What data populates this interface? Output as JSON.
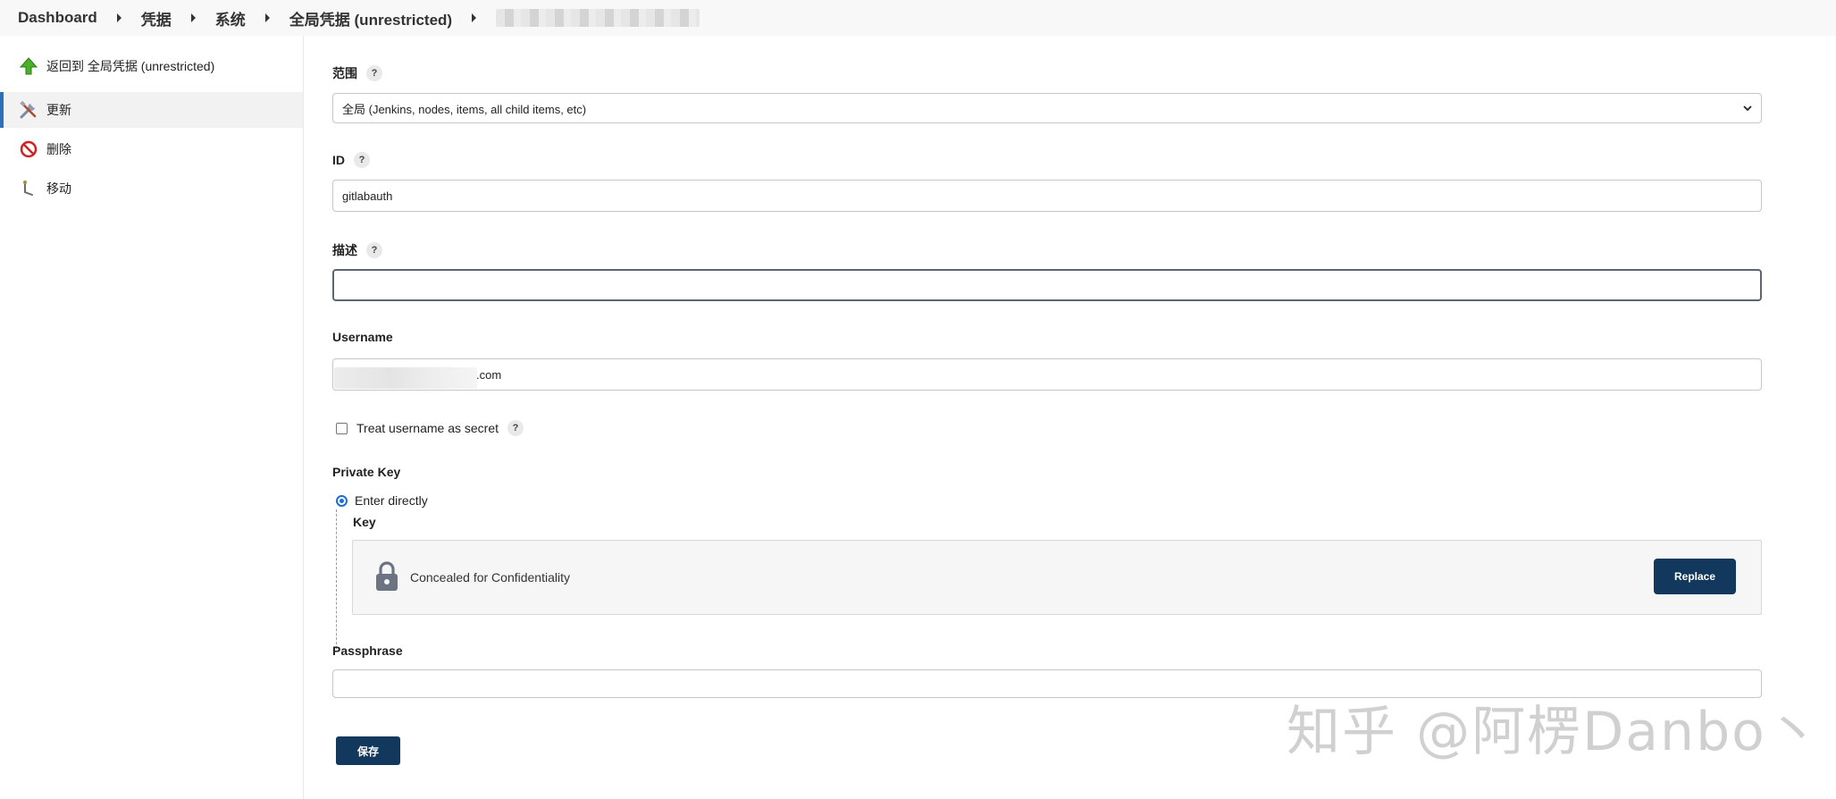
{
  "breadcrumb": {
    "items": [
      "Dashboard",
      "凭据",
      "系统",
      "全局凭据 (unrestricted)"
    ]
  },
  "sidebar": {
    "items": [
      {
        "label": "返回到 全局凭据 (unrestricted)",
        "icon": "arrow-up-icon"
      },
      {
        "label": "更新",
        "icon": "tools-icon"
      },
      {
        "label": "删除",
        "icon": "no-entry-icon"
      },
      {
        "label": "移动",
        "icon": "move-icon"
      }
    ],
    "active_index": 1
  },
  "form": {
    "scope": {
      "label": "范围",
      "help": "?",
      "value": "全局 (Jenkins, nodes, items, all child items, etc)"
    },
    "id": {
      "label": "ID",
      "help": "?",
      "value": "gitlabauth"
    },
    "description": {
      "label": "描述",
      "help": "?",
      "value": ""
    },
    "username": {
      "label": "Username",
      "value_suffix": ".com"
    },
    "treat_secret": {
      "label": "Treat username as secret",
      "help": "?",
      "checked": false
    },
    "private_key": {
      "label": "Private Key",
      "option": "Enter directly",
      "key_label": "Key",
      "concealed_text": "Concealed for Confidentiality",
      "replace_label": "Replace"
    },
    "passphrase": {
      "label": "Passphrase",
      "value": ""
    },
    "save_label": "保存"
  },
  "watermark": "知乎 @阿楞Danbo丶",
  "colors": {
    "accent": "#12395d",
    "radio": "#1f6fd1",
    "active_bar": "#2e6fba"
  }
}
